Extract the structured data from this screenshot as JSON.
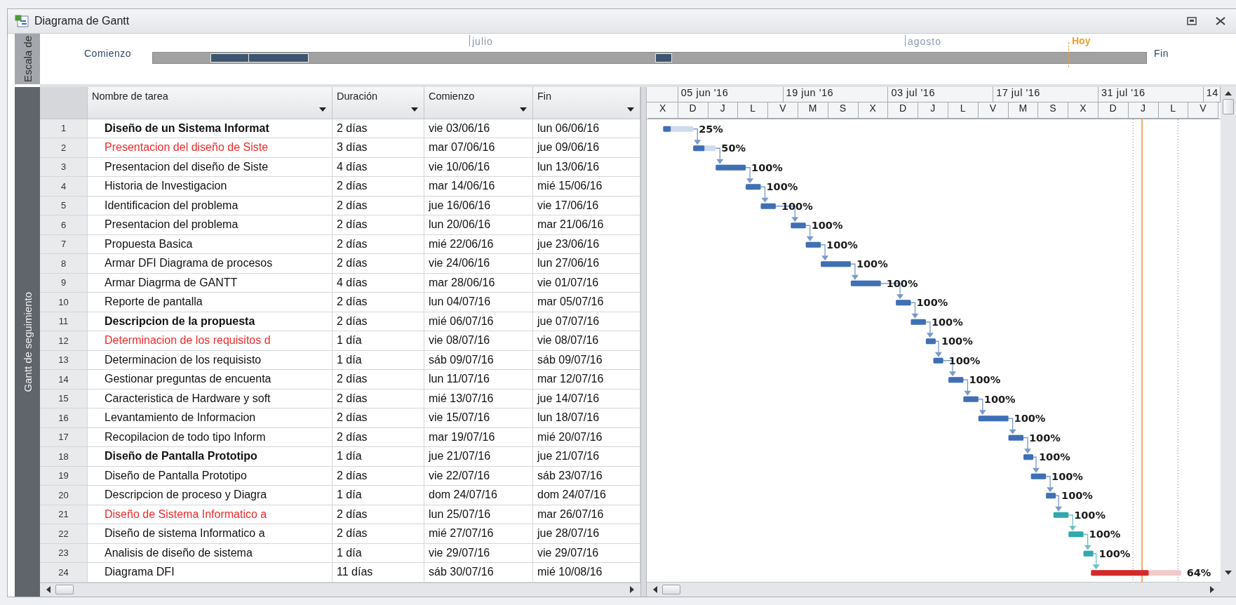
{
  "window": {
    "title": "Diagrama de Gantt"
  },
  "timeline": {
    "side_label": "Escala de",
    "start_label": "Comienzo",
    "end_label": "Fin",
    "months": [
      "julio",
      "agosto"
    ],
    "today_label": "Hoy"
  },
  "side_label": "Gantt de seguimiento",
  "table": {
    "columns": [
      "Nombre de tarea",
      "Duración",
      "Comienzo",
      "Fin"
    ],
    "rows": [
      {
        "id": "1",
        "name": "Diseño de un Sistema Informat",
        "duration": "2 días",
        "start": "vie 03/06/16",
        "finish": "lun 06/06/16",
        "bold": true,
        "highlighted": false,
        "bar": {
          "level": 0.25,
          "label": "25%",
          "color": "#3f6fb5"
        }
      },
      {
        "id": "2",
        "name": "Presentacion del diseño de Siste",
        "duration": "3 días",
        "start": "mar 07/06/16",
        "finish": "jue 09/06/16",
        "bold": false,
        "highlighted": true,
        "bar": {
          "level": 0.5,
          "label": "50%",
          "color": "#3f6fb5"
        }
      },
      {
        "id": "3",
        "name": "Presentacion del diseño de Siste",
        "duration": "4 días",
        "start": "vie 10/06/16",
        "finish": "lun 13/06/16",
        "bold": false,
        "highlighted": false,
        "bar": {
          "level": 1,
          "label": "100%",
          "color": "#3f6fb5"
        }
      },
      {
        "id": "4",
        "name": "Historia de Investigacion",
        "duration": "2 días",
        "start": "mar 14/06/16",
        "finish": "mié 15/06/16",
        "bold": false,
        "highlighted": false,
        "bar": {
          "level": 1,
          "label": "100%",
          "color": "#3f6fb5"
        }
      },
      {
        "id": "5",
        "name": "Identificacion del problema",
        "duration": "2 días",
        "start": "jue 16/06/16",
        "finish": "vie 17/06/16",
        "bold": false,
        "highlighted": false,
        "bar": {
          "level": 1,
          "label": "100%",
          "color": "#3f6fb5"
        }
      },
      {
        "id": "6",
        "name": "Presentacion del problema",
        "duration": "2 días",
        "start": "lun 20/06/16",
        "finish": "mar 21/06/16",
        "bold": false,
        "highlighted": false,
        "bar": {
          "level": 1,
          "label": "100%",
          "color": "#3f6fb5"
        }
      },
      {
        "id": "7",
        "name": "Propuesta Basica",
        "duration": "2 días",
        "start": "mié 22/06/16",
        "finish": "jue 23/06/16",
        "bold": false,
        "highlighted": false,
        "bar": {
          "level": 1,
          "label": "100%",
          "color": "#3f6fb5"
        }
      },
      {
        "id": "8",
        "name": "Armar DFI Diagrama de procesos",
        "duration": "2 días",
        "start": "vie 24/06/16",
        "finish": "lun 27/06/16",
        "bold": false,
        "highlighted": false,
        "bar": {
          "level": 1,
          "label": "100%",
          "color": "#3f6fb5"
        }
      },
      {
        "id": "9",
        "name": "Armar Diagrma de GANTT",
        "duration": "4 días",
        "start": "mar 28/06/16",
        "finish": "vie 01/07/16",
        "bold": false,
        "highlighted": false,
        "bar": {
          "level": 1,
          "label": "100%",
          "color": "#3f6fb5"
        }
      },
      {
        "id": "10",
        "name": "Reporte de pantalla",
        "duration": "2 días",
        "start": "lun 04/07/16",
        "finish": "mar 05/07/16",
        "bold": false,
        "highlighted": false,
        "bar": {
          "level": 1,
          "label": "100%",
          "color": "#3f6fb5"
        }
      },
      {
        "id": "11",
        "name": "Descripcion de la propuesta",
        "duration": "2 días",
        "start": "mié 06/07/16",
        "finish": "jue 07/07/16",
        "bold": true,
        "highlighted": false,
        "bar": {
          "level": 1,
          "label": "100%",
          "color": "#3f6fb5"
        }
      },
      {
        "id": "12",
        "name": "Determinacion de los requisitos d",
        "duration": "1 día",
        "start": "vie 08/07/16",
        "finish": "vie 08/07/16",
        "bold": false,
        "highlighted": true,
        "bar": {
          "level": 1,
          "label": "100%",
          "color": "#3f6fb5"
        }
      },
      {
        "id": "13",
        "name": "Determinacion de los requisisto",
        "duration": "1 día",
        "start": "sáb 09/07/16",
        "finish": "sáb 09/07/16",
        "bold": false,
        "highlighted": false,
        "bar": {
          "level": 1,
          "label": "100%",
          "color": "#3f6fb5"
        }
      },
      {
        "id": "14",
        "name": "Gestionar preguntas de encuenta",
        "duration": "2 días",
        "start": "lun 11/07/16",
        "finish": "mar 12/07/16",
        "bold": false,
        "highlighted": false,
        "bar": {
          "level": 1,
          "label": "100%",
          "color": "#3f6fb5"
        }
      },
      {
        "id": "15",
        "name": "Caracteristica de Hardware y soft",
        "duration": "2 días",
        "start": "mié 13/07/16",
        "finish": "jue 14/07/16",
        "bold": false,
        "highlighted": false,
        "bar": {
          "level": 1,
          "label": "100%",
          "color": "#3f6fb5"
        }
      },
      {
        "id": "16",
        "name": "Levantamiento de Informacion",
        "duration": "2 días",
        "start": "vie 15/07/16",
        "finish": "lun 18/07/16",
        "bold": false,
        "highlighted": false,
        "bar": {
          "level": 1,
          "label": "100%",
          "color": "#3f6fb5"
        }
      },
      {
        "id": "17",
        "name": "Recopilacion de todo tipo Inform",
        "duration": "2 días",
        "start": "mar 19/07/16",
        "finish": "mié 20/07/16",
        "bold": false,
        "highlighted": false,
        "bar": {
          "level": 1,
          "label": "100%",
          "color": "#3f6fb5"
        }
      },
      {
        "id": "18",
        "name": "Diseño de Pantalla Prototipo",
        "duration": "1 día",
        "start": "jue 21/07/16",
        "finish": "jue 21/07/16",
        "bold": true,
        "highlighted": false,
        "bar": {
          "level": 1,
          "label": "100%",
          "color": "#3f6fb5"
        }
      },
      {
        "id": "19",
        "name": "Diseño de Pantalla Prototipo",
        "duration": "2 días",
        "start": "vie 22/07/16",
        "finish": "sáb 23/07/16",
        "bold": false,
        "highlighted": false,
        "bar": {
          "level": 1,
          "label": "100%",
          "color": "#3f6fb5"
        }
      },
      {
        "id": "20",
        "name": "Descripcion de proceso y Diagra",
        "duration": "1 día",
        "start": "dom 24/07/16",
        "finish": "dom 24/07/16",
        "bold": false,
        "highlighted": false,
        "bar": {
          "level": 1,
          "label": "100%",
          "color": "#3f6fb5"
        }
      },
      {
        "id": "21",
        "name": "Diseño de Sistema Informatico a",
        "duration": "2 días",
        "start": "lun 25/07/16",
        "finish": "mar 26/07/16",
        "bold": false,
        "highlighted": true,
        "bar": {
          "level": 1,
          "label": "100%",
          "color": "#2fa8ae"
        }
      },
      {
        "id": "22",
        "name": "Diseño de sistema Informatico a",
        "duration": "2 días",
        "start": "mié 27/07/16",
        "finish": "jue 28/07/16",
        "bold": false,
        "highlighted": false,
        "bar": {
          "level": 1,
          "label": "100%",
          "color": "#2fa8ae"
        }
      },
      {
        "id": "23",
        "name": "Analisis de diseño de sistema",
        "duration": "1 día",
        "start": "vie 29/07/16",
        "finish": "vie 29/07/16",
        "bold": false,
        "highlighted": false,
        "bar": {
          "level": 1,
          "label": "100%",
          "color": "#2fa8ae"
        }
      },
      {
        "id": "24",
        "name": "Diagrama DFI",
        "duration": "11 días",
        "start": "sáb 30/07/16",
        "finish": "mié 10/08/16",
        "bold": false,
        "highlighted": false,
        "bar": {
          "level": 0.64,
          "label": "64%",
          "color": "#d02a2a"
        }
      }
    ]
  },
  "gantt": {
    "weeks": [
      "05 jun '16",
      "19 jun '16",
      "03 jul '16",
      "17 jul '16",
      "31 jul '16",
      "14"
    ],
    "days": [
      "X",
      "D",
      "J",
      "L",
      "V",
      "M",
      "S",
      "X",
      "D",
      "J",
      "L",
      "V",
      "M",
      "S",
      "X",
      "D",
      "J",
      "L",
      "V"
    ]
  }
}
